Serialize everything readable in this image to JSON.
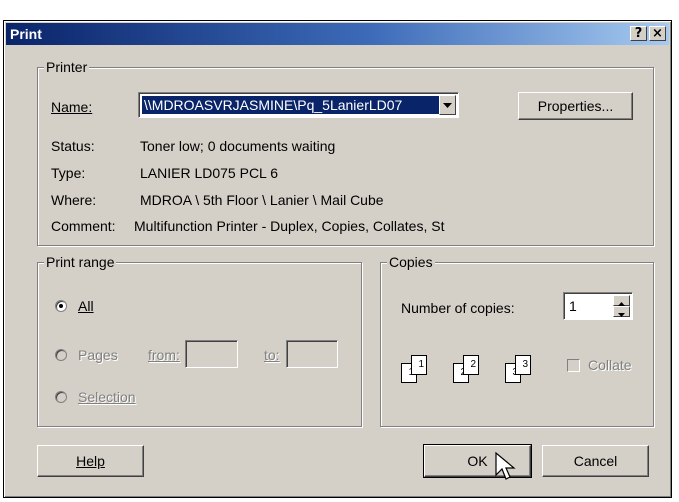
{
  "window": {
    "title": "Print",
    "help_button": "?",
    "close_button": "×"
  },
  "printer": {
    "group_label": "Printer",
    "name_label": "Name:",
    "name_value": "\\\\MDROASVRJASMINE\\Pq_5LanierLD07",
    "properties_label": "Properties...",
    "status_label": "Status:",
    "status_value": "Toner low; 0 documents waiting",
    "type_label": "Type:",
    "type_value": "LANIER LD075 PCL 6",
    "where_label": "Where:",
    "where_value": "MDROA \\ 5th Floor \\ Lanier \\ Mail Cube",
    "comment_label": "Comment:",
    "comment_value": "Multifunction Printer - Duplex, Copies, Collates, St"
  },
  "print_range": {
    "group_label": "Print range",
    "all_label": "All",
    "pages_label": "Pages",
    "from_label": "from:",
    "to_label": "to:",
    "from_value": "",
    "to_value": "",
    "selection_label": "Selection",
    "selected": "All"
  },
  "copies": {
    "group_label": "Copies",
    "number_label": "Number of copies:",
    "number_value": "1",
    "collate_label": "Collate",
    "collate_checked": false,
    "page_numbers": [
      "1",
      "1",
      "2",
      "2",
      "3",
      "3"
    ]
  },
  "buttons": {
    "help": "Help",
    "ok": "OK",
    "cancel": "Cancel"
  },
  "icons": {
    "dropdown": "chevron-down-icon",
    "spinner": "spinner-arrows-icon",
    "cursor": "mouse-pointer-icon"
  }
}
